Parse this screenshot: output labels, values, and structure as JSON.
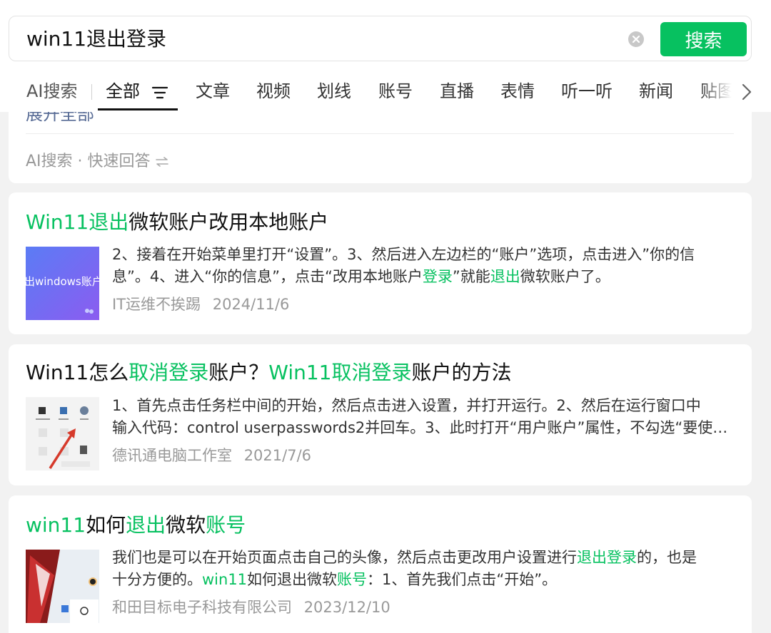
{
  "search": {
    "query": "win11退出登录",
    "button_label": "搜索"
  },
  "tabs": {
    "ai": "AI搜索",
    "active": "全部",
    "items": [
      "文章",
      "视频",
      "划线",
      "账号",
      "直播",
      "表情",
      "听一听",
      "新闻",
      "贴图"
    ]
  },
  "ai_card": {
    "expand_partial": "展开全部",
    "quick_answer": "AI搜索 · 快速回答"
  },
  "results": [
    {
      "title": [
        {
          "text": "Win11退出",
          "hl": true
        },
        {
          "text": "微软账户改用本地账户",
          "hl": false
        }
      ],
      "thumb_text": "出windows账户",
      "snippet_lines": [
        [
          {
            "text": "2、接着在开始菜单里打开“设置”。3、然后进入左边栏的“账户”选项，点击进入”你的信",
            "hl": false
          }
        ],
        [
          {
            "text": "息”。4、进入“你的信息”，点击“改用本地账户",
            "hl": false
          },
          {
            "text": "登录",
            "hl": true
          },
          {
            "text": "”就能",
            "hl": false
          },
          {
            "text": "退出",
            "hl": true
          },
          {
            "text": "微软账户了。",
            "hl": false
          }
        ]
      ],
      "source": "IT运维不挨踢",
      "date": "2024/11/6"
    },
    {
      "title": [
        {
          "text": "Win11怎么",
          "hl": false
        },
        {
          "text": "取消登录",
          "hl": true
        },
        {
          "text": "账户？",
          "hl": false
        },
        {
          "text": "Win11取消登录",
          "hl": true
        },
        {
          "text": "账户的方法",
          "hl": false
        }
      ],
      "snippet_lines": [
        [
          {
            "text": "1、首先点击任务栏中间的开始，然后点击进入设置，并打开运行。2、然后在运行窗口中",
            "hl": false
          }
        ],
        [
          {
            "text": "输入代码：control userpasswords2并回车。3、此时打开“用户账户”属性，不勾选“要使用本机",
            "hl": false
          }
        ]
      ],
      "source": "德讯通电脑工作室",
      "date": "2021/7/6"
    },
    {
      "title": [
        {
          "text": "win11",
          "hl": true
        },
        {
          "text": "如何",
          "hl": false
        },
        {
          "text": "退出",
          "hl": true
        },
        {
          "text": "微软",
          "hl": false
        },
        {
          "text": "账号",
          "hl": true
        }
      ],
      "snippet_lines": [
        [
          {
            "text": "我们也是可以在开始页面点击自己的头像，然后点击更改用户设置进行",
            "hl": false
          },
          {
            "text": "退出登录",
            "hl": true
          },
          {
            "text": "的，也是",
            "hl": false
          }
        ],
        [
          {
            "text": "十分方便的。",
            "hl": false
          },
          {
            "text": "win11",
            "hl": true
          },
          {
            "text": "如何退出微软",
            "hl": false
          },
          {
            "text": "账号",
            "hl": true
          },
          {
            "text": "：1、首先我们点击“开始”。",
            "hl": false
          }
        ]
      ],
      "source": "和田目标电子科技有限公司",
      "date": "2023/12/10"
    }
  ],
  "colors": {
    "accent": "#07c160",
    "page_bg": "#f2f2f2",
    "meta_text": "#999999"
  }
}
